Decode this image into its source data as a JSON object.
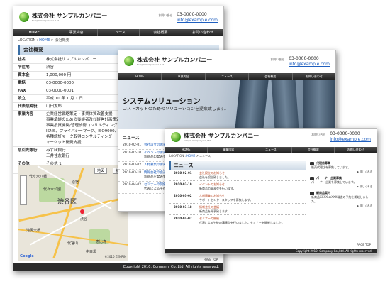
{
  "company": {
    "name": "株式会社 サンプルカンパニー",
    "sub": "Sample Company Co.,Ltd.",
    "contact_label": "お問い合せ",
    "phone": "03-0000-0000",
    "email": "info@example.com"
  },
  "nav": [
    "HOME",
    "事業内容",
    "ニュース",
    "会社概要",
    "お問い合わせ"
  ],
  "footer": "Copyright 2010. Company Co.,Ltd. All rights reserved.",
  "page_top": "PAGE TOP",
  "profile": {
    "crumb_label": "LOCATION",
    "crumb_home": "HOME",
    "crumb_current": "会社概要",
    "title": "会社概要",
    "rows": [
      {
        "k": "社名",
        "v": [
          "株式会社サンプルカンパニー"
        ]
      },
      {
        "k": "所在地",
        "v": [
          "渋谷"
        ]
      },
      {
        "k": "資本金",
        "v": [
          "1,000,000 円"
        ]
      },
      {
        "k": "電話",
        "v": [
          "03-0000-0000"
        ]
      },
      {
        "k": "FAX",
        "v": [
          "03-0000-0001"
        ]
      },
      {
        "k": "設立",
        "v": [
          "平成 10 年 1 月 1 日"
        ]
      },
      {
        "k": "代表取締役",
        "v": [
          "山田太郎"
        ]
      },
      {
        "k": "事業内容",
        "v": [
          "企業経営戦略策定・事業体質改善支援",
          "事業承継のための後継者及び経営計画策定",
          "事業投資機関/管理技術コンサルティング",
          "ISMS、プライバシーマーク、ISO9000、1400",
          "各種認証マーク取得コンサルティング",
          "マーケット開発支援"
        ]
      },
      {
        "k": "取引先銀行",
        "v": [
          "みずほ銀行",
          "三井住友銀行"
        ]
      },
      {
        "k": "その他",
        "v": [
          "その他 1",
          "その他 2"
        ]
      }
    ]
  },
  "map": {
    "btn_map": "地図",
    "btn_sat": "航空",
    "labels": [
      "代々木八幡",
      "代々木公園",
      "渋谷区",
      "恵比寿",
      "中目黒",
      "池尻大橋",
      "代官山",
      "渋谷",
      "原宿"
    ],
    "google": "Google",
    "copyright": "©2010 ZENRIN"
  },
  "hero": {
    "title": "システムソリューション",
    "subtitle": "コストカットのためのソリューションを提案致します。"
  },
  "news2": {
    "title": "ニュース",
    "items": [
      {
        "date": "2010-02-01",
        "title": "会社設立のお知らせ",
        "body": ""
      },
      {
        "date": "2010-02-10",
        "title": "イベントのお知らせ",
        "body": "新商品の発表会を行います。"
      },
      {
        "date": "2010-03-02",
        "title": "人材募集のお知らせ",
        "body": ""
      },
      {
        "date": "2010-03-18",
        "title": "情報会社の会議",
        "body": "新商品を発表致します。"
      },
      {
        "date": "2010-04-02",
        "title": "セミナーの開催",
        "body": "代表による午後の講演会を開催しました。"
      }
    ]
  },
  "news3": {
    "crumb_label": "LOCATION",
    "crumb_home": "HOME",
    "crumb_current": "ニュース",
    "title": "ニュース",
    "items": [
      {
        "date": "2010-02-01",
        "title": "会社設立のお知らせ",
        "body": "会社を設立致しました。"
      },
      {
        "date": "2010-02-10",
        "title": "イベントのお知らせ",
        "body": "新商品の発表会を行います。"
      },
      {
        "date": "2010-03-02",
        "title": "人材募集のお知らせ",
        "body": "サポートセンタースタッフを募集します。"
      },
      {
        "date": "2010-03-18",
        "title": "情報会社の会議",
        "body": "新商品を発表致します。"
      },
      {
        "date": "2010-04-02",
        "title": "セミナーの開催",
        "body": "代表による午後の講演会を行いました。セミナーを開催しました。"
      }
    ],
    "side": [
      {
        "head": "代理店募集",
        "text": "販売代理店を募集しています。",
        "more": "▶ 詳しくみる"
      },
      {
        "head": "パートナー企業募集",
        "text": "パートナー企業を募集しています。",
        "more": "▶ 詳しくみる"
      },
      {
        "head": "新商品案内",
        "text": "新商品XXXX のXXX製造の予約を開始しました。",
        "more": "▶ 詳しくみる"
      }
    ]
  }
}
